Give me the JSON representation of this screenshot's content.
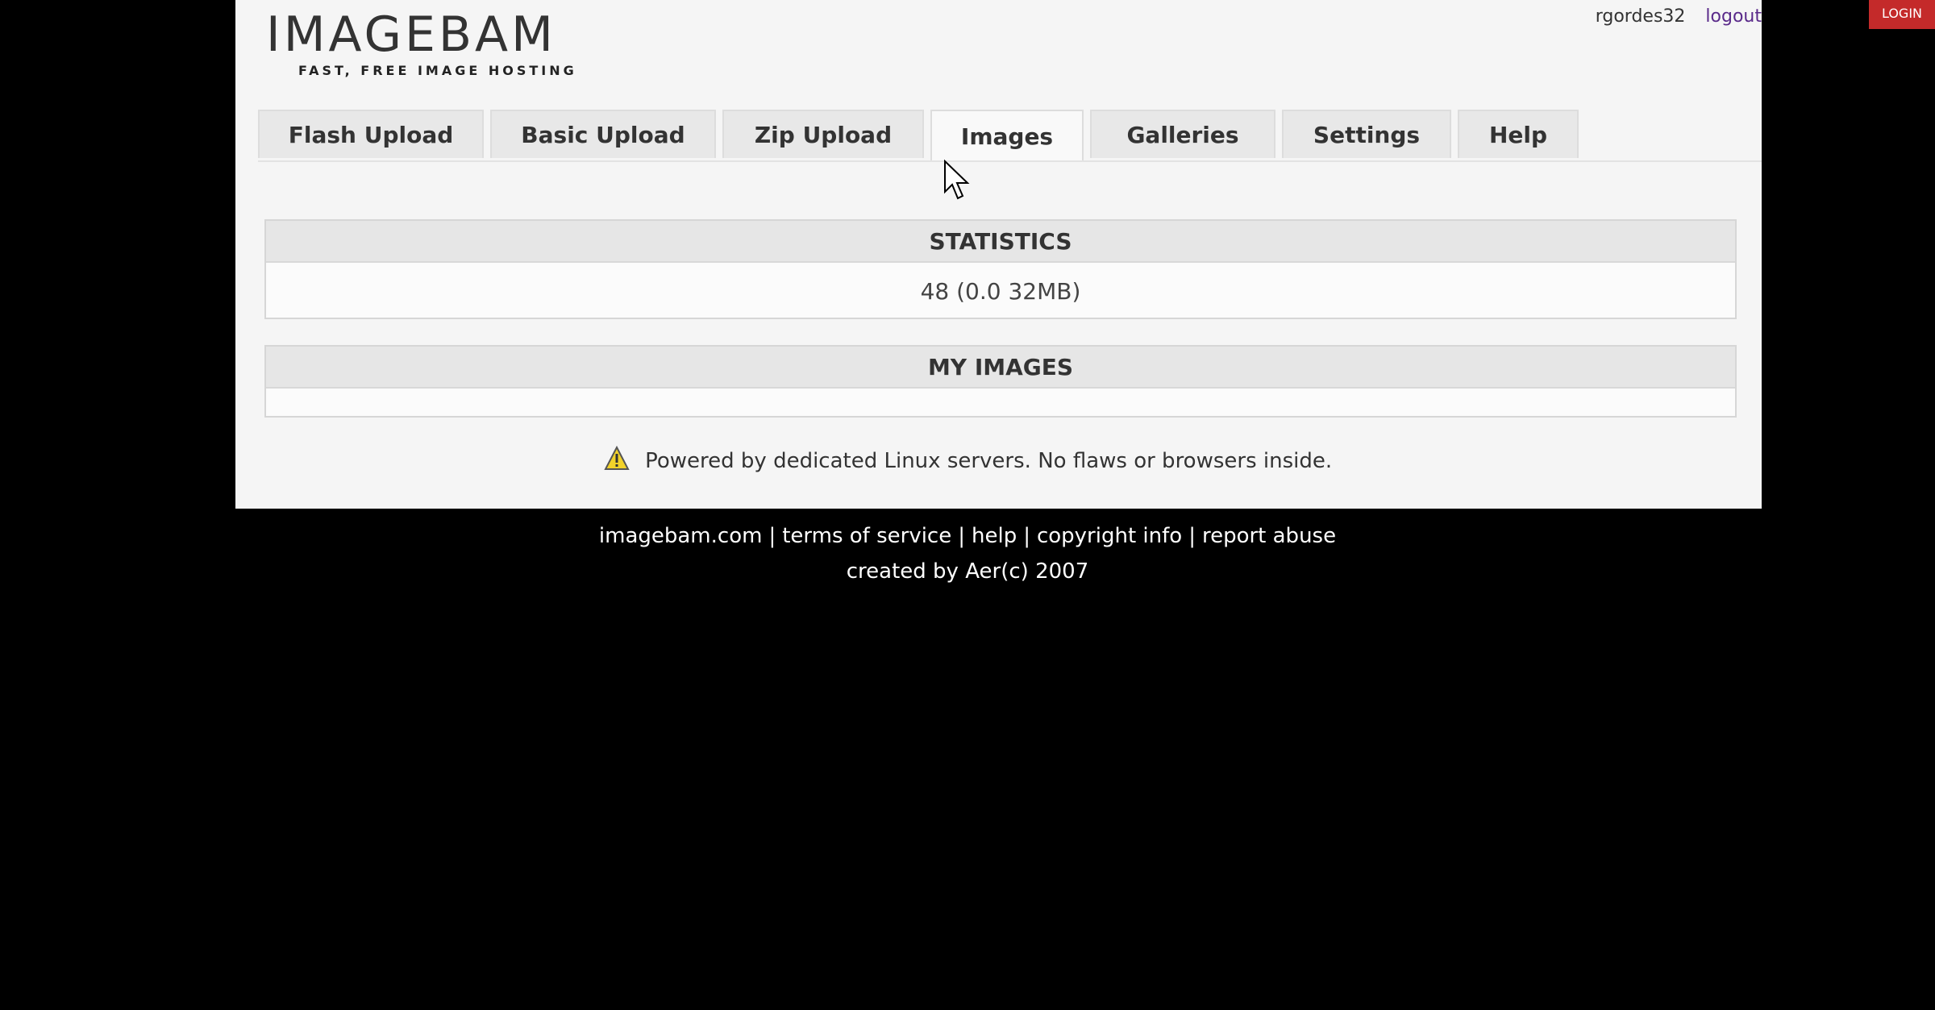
{
  "header": {
    "logo_title": "IMAGEBAM",
    "logo_tagline": "FAST, FREE IMAGE HOSTING",
    "username": "rgordes32",
    "logout_label": "logout",
    "corner_badge": "LOGIN"
  },
  "tabs": [
    {
      "label": "Flash Upload",
      "active": false
    },
    {
      "label": "Basic Upload",
      "active": false
    },
    {
      "label": "Zip Upload",
      "active": false
    },
    {
      "label": "Images",
      "active": true
    },
    {
      "label": "Galleries",
      "active": false
    },
    {
      "label": "Settings",
      "active": false
    },
    {
      "label": "Help",
      "active": false
    }
  ],
  "statistics": {
    "title": "STATISTICS",
    "value": "48 (0.0 32MB)"
  },
  "my_images": {
    "title": "MY IMAGES",
    "body": ""
  },
  "notice": {
    "icon": "warning-icon",
    "text": "Powered by dedicated Linux servers. No flaws or browsers inside."
  },
  "footer": {
    "links": [
      "imagebam.com",
      "terms of service",
      "help",
      "copyright info",
      "report abuse"
    ],
    "copyright": "created by Aer(c) 2007"
  },
  "colors": {
    "page_bg": "#000000",
    "panel_bg": "#f5f5f5",
    "tab_bg": "#e8e8e8",
    "section_header_bg": "#e6e6e6",
    "logout_link": "#5a2a8a",
    "badge": "#c42a2a"
  }
}
